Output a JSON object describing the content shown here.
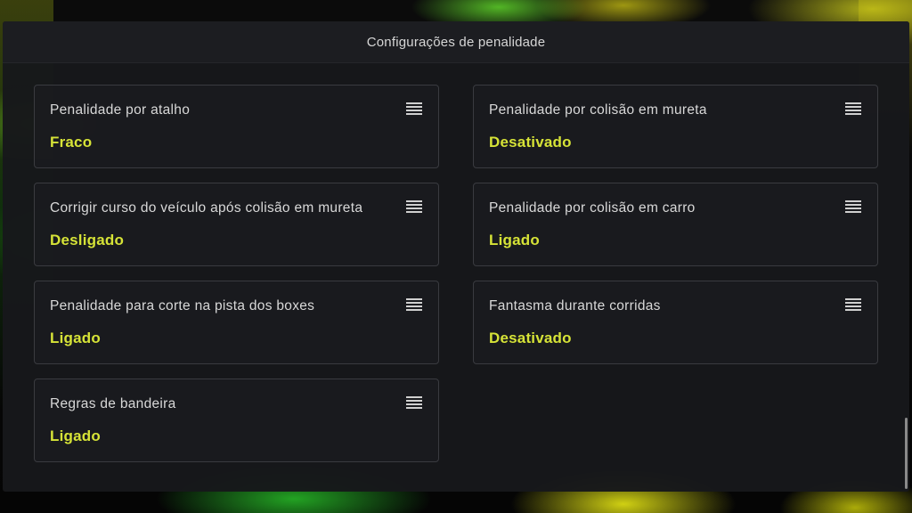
{
  "header": {
    "title": "Configurações de penalidade"
  },
  "settings": [
    {
      "label": "Penalidade por atalho",
      "value": "Fraco",
      "icon": "menu-icon"
    },
    {
      "label": "Penalidade por colisão em mureta",
      "value": "Desativado",
      "icon": "menu-icon"
    },
    {
      "label": "Corrigir curso do veículo após colisão em mureta",
      "value": "Desligado",
      "icon": "menu-icon"
    },
    {
      "label": "Penalidade por colisão em carro",
      "value": "Ligado",
      "icon": "menu-icon"
    },
    {
      "label": "Penalidade para corte na pista dos boxes",
      "value": "Ligado",
      "icon": "menu-icon"
    },
    {
      "label": "Fantasma durante corridas",
      "value": "Desativado",
      "icon": "menu-icon"
    },
    {
      "label": "Regras de bandeira",
      "value": "Ligado",
      "icon": "menu-icon"
    }
  ],
  "colors": {
    "accent_value": "#d6e337",
    "panel_bg": "#17181b",
    "card_border": "#3a3b40"
  }
}
